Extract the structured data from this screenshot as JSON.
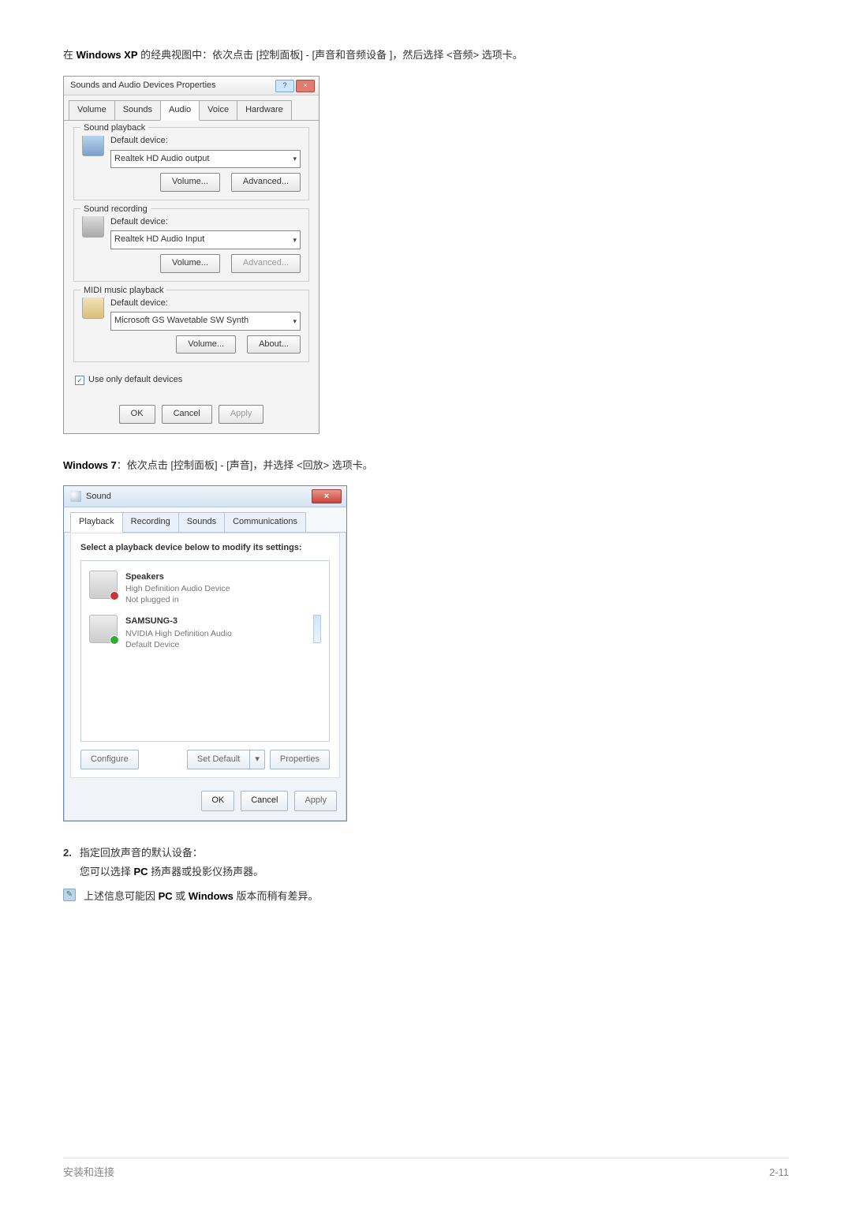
{
  "intro_xp": {
    "prefix": "在 ",
    "winxp": "Windows XP",
    "rest": " 的经典视图中：依次点击 [控制面板] - [声音和音频设备 ]，然后选择 <音频> 选项卡。"
  },
  "xp_dialog": {
    "title": "Sounds and Audio Devices Properties",
    "help": "?",
    "close": "×",
    "tabs": {
      "volume": "Volume",
      "sounds": "Sounds",
      "audio": "Audio",
      "voice": "Voice",
      "hardware": "Hardware"
    },
    "groups": {
      "playback": {
        "title": "Sound playback",
        "label": "Default device:",
        "value": "Realtek HD Audio output",
        "btn_vol": "Volume...",
        "btn_adv": "Advanced..."
      },
      "recording": {
        "title": "Sound recording",
        "label": "Default device:",
        "value": "Realtek HD Audio Input",
        "btn_vol": "Volume...",
        "btn_adv": "Advanced..."
      },
      "midi": {
        "title": "MIDI music playback",
        "label": "Default device:",
        "value": "Microsoft GS Wavetable SW Synth",
        "btn_vol": "Volume...",
        "btn_about": "About..."
      }
    },
    "checkbox": "Use only default devices",
    "check_mark": "✓",
    "footer": {
      "ok": "OK",
      "cancel": "Cancel",
      "apply": "Apply"
    }
  },
  "intro_w7": {
    "win7": "Windows 7",
    "rest": "：依次点击 [控制面板] - [声音]，并选择 <回放> 选项卡。"
  },
  "w7_dialog": {
    "title": "Sound",
    "close": "×",
    "tabs": {
      "playback": "Playback",
      "recording": "Recording",
      "sounds": "Sounds",
      "comm": "Communications"
    },
    "prompt": "Select a playback device below to modify its settings:",
    "items": [
      {
        "name": "Speakers",
        "desc": "High Definition Audio Device",
        "status": "Not plugged in"
      },
      {
        "name": "SAMSUNG-3",
        "desc": "NVIDIA High Definition Audio",
        "status": "Default Device"
      }
    ],
    "buttons": {
      "configure": "Configure",
      "setdefault": "Set Default",
      "drop": "▾",
      "properties": "Properties"
    },
    "footer": {
      "ok": "OK",
      "cancel": "Cancel",
      "apply": "Apply"
    }
  },
  "step2": {
    "num": "2.",
    "line1": "指定回放声音的默认设备：",
    "line2a": "您可以选择 ",
    "pc": "PC",
    "line2b": " 扬声器或投影仪扬声器。"
  },
  "note": {
    "icon": "✎",
    "a": "上述信息可能因 ",
    "pc": "PC",
    "b": " 或 ",
    "win": "Windows",
    "c": " 版本而稍有差异。"
  },
  "footer": {
    "left": "安装和连接",
    "right": "2-11"
  }
}
